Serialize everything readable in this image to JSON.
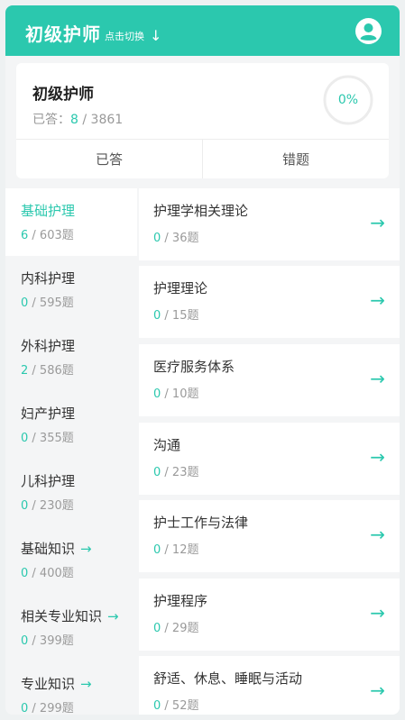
{
  "header": {
    "title": "初级护师",
    "switch_label": "点击切换",
    "switch_arrow": "↓"
  },
  "summary": {
    "exam_name": "初级护师",
    "answered_prefix": "已答：",
    "answered": "8",
    "total": " / 3861",
    "progress_text": "0%",
    "progress_fraction": 0,
    "tabs": [
      "已答",
      "错题"
    ]
  },
  "sidebar": {
    "items": [
      {
        "label": "基础护理",
        "done": "6",
        "total": " / 603题",
        "active": true,
        "arrow": ""
      },
      {
        "label": "内科护理",
        "done": "0",
        "total": " / 595题",
        "active": false,
        "arrow": ""
      },
      {
        "label": "外科护理",
        "done": "2",
        "total": " / 586题",
        "active": false,
        "arrow": ""
      },
      {
        "label": "妇产护理",
        "done": "0",
        "total": " / 355题",
        "active": false,
        "arrow": ""
      },
      {
        "label": "儿科护理",
        "done": "0",
        "total": " / 230题",
        "active": false,
        "arrow": ""
      },
      {
        "label": "基础知识",
        "done": "0",
        "total": " / 400题",
        "active": false,
        "arrow": "→"
      },
      {
        "label": "相关专业知识",
        "done": "0",
        "total": " / 399题",
        "active": false,
        "arrow": "→"
      },
      {
        "label": "专业知识",
        "done": "0",
        "total": " / 299题",
        "active": false,
        "arrow": "→"
      }
    ]
  },
  "chapters": {
    "arrow": "→",
    "items": [
      {
        "label": "护理学相关理论",
        "done": "0",
        "total": " / 36题"
      },
      {
        "label": "护理理论",
        "done": "0",
        "total": " / 15题"
      },
      {
        "label": "医疗服务体系",
        "done": "0",
        "total": " / 10题"
      },
      {
        "label": "沟通",
        "done": "0",
        "total": " / 23题"
      },
      {
        "label": "护士工作与法律",
        "done": "0",
        "total": " / 12题"
      },
      {
        "label": "护理程序",
        "done": "0",
        "total": " / 29题"
      },
      {
        "label": "舒适、休息、睡眠与活动",
        "done": "0",
        "total": " / 52题"
      }
    ]
  },
  "colors": {
    "accent": "#2bc8ae",
    "muted": "#9a9a9a"
  }
}
